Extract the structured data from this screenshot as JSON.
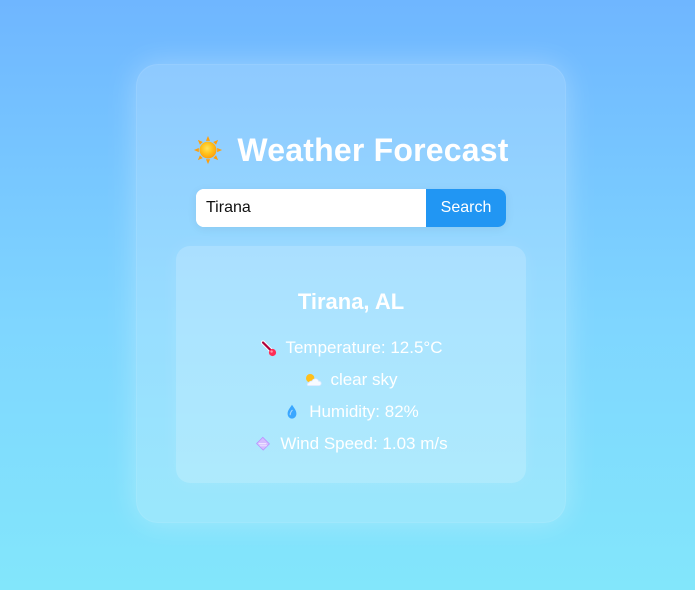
{
  "app": {
    "title": "Weather Forecast",
    "title_icon": "sun-icon"
  },
  "search": {
    "value": "Tirana",
    "button_label": "Search"
  },
  "weather": {
    "city_label": "Tirana, AL",
    "rows": [
      {
        "icon": "thermometer-icon",
        "text": "Temperature: 12.5°C"
      },
      {
        "icon": "sun-cloud-icon",
        "text": "clear sky"
      },
      {
        "icon": "droplet-icon",
        "text": "Humidity: 82%"
      },
      {
        "icon": "wind-icon",
        "text": "Wind Speed: 1.03 m/s"
      }
    ]
  },
  "colors": {
    "accent": "#2196f3",
    "background_top": "#6fb6ff",
    "background_bottom": "#82e6fb"
  }
}
